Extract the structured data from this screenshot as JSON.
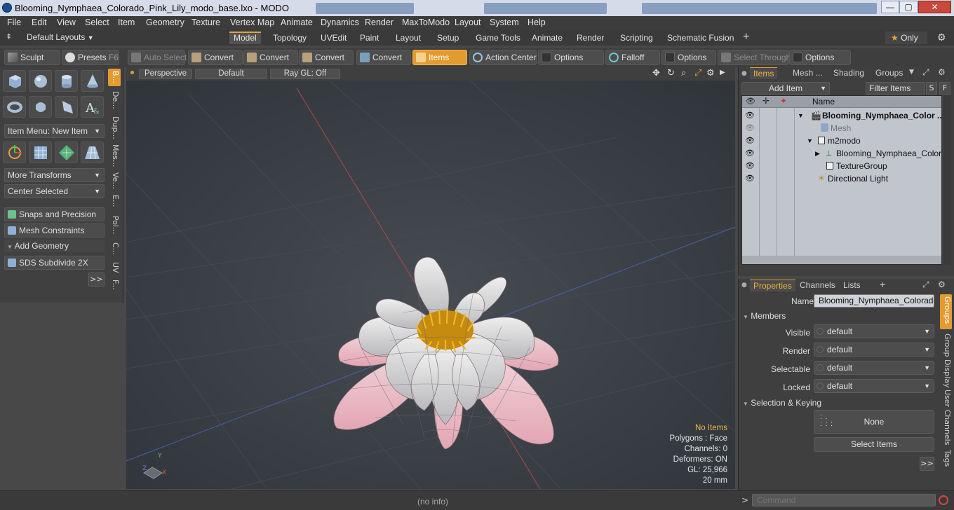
{
  "window": {
    "title": "Blooming_Nymphaea_Colorado_Pink_Lily_modo_base.lxo - MODO",
    "minimize": "—",
    "maximize": "▢",
    "close": "✕"
  },
  "menu": [
    "File",
    "Edit",
    "View",
    "Select",
    "Item",
    "Geometry",
    "Texture",
    "Vertex Map",
    "Animate",
    "Dynamics",
    "Render",
    "MaxToModo",
    "Layout",
    "System",
    "Help"
  ],
  "layout_bar": {
    "layouts_label": "Default Layouts",
    "tabs": [
      "Model",
      "Topology",
      "UVEdit",
      "Paint",
      "Layout",
      "Setup",
      "Game Tools",
      "Animate",
      "Render",
      "Scripting",
      "Schematic Fusion"
    ],
    "active_tab": "Model",
    "add": "+",
    "only_label": "Only"
  },
  "toolbar": {
    "sculpt": "Sculpt",
    "presets": "Presets",
    "presets_key": "F6",
    "auto_select": "Auto Select",
    "convert1": "Convert",
    "convert2": "Convert",
    "convert3": "Convert",
    "convert4": "Convert",
    "items": "Items",
    "action_center": "Action Center",
    "options1": "Options",
    "falloff": "Falloff",
    "options2": "Options",
    "select_through": "Select Through",
    "options3": "Options"
  },
  "left_panel": {
    "item_menu": "Item Menu: New Item",
    "more_transforms": "More Transforms",
    "center_selected": "Center Selected",
    "snaps": "Snaps and Precision",
    "mesh_constraints": "Mesh Constraints",
    "add_geometry": "Add Geometry",
    "sds": "SDS Subdivide 2X",
    "more": ">>",
    "vertical_tabs": [
      "B...",
      "De...",
      "Dup...",
      "Mes...",
      "Ve...",
      "E...",
      "Pol...",
      "C...",
      "UV",
      "F..."
    ]
  },
  "viewport": {
    "view": "Perspective",
    "shading": "Default",
    "raygl": "Ray GL: Off",
    "stats": {
      "no_items": "No Items",
      "polygons": "Polygons : Face",
      "channels": "Channels: 0",
      "deformers": "Deformers: ON",
      "gl": "GL: 25,966",
      "scale": "20 mm"
    }
  },
  "items_panel": {
    "tabs": [
      "Items",
      "Mesh ...",
      "Shading",
      "Groups"
    ],
    "active_tab": "Items",
    "add_item": "Add Item",
    "filter_items": "Filter Items",
    "s_btn": "S",
    "f_btn": "F",
    "col_name": "Name",
    "rows": [
      {
        "label": "Blooming_Nymphaea_Color ...",
        "bold": true
      },
      {
        "label": "Mesh",
        "dim": true
      },
      {
        "label": "m2modo"
      },
      {
        "label": "Blooming_Nymphaea_Color ..."
      },
      {
        "label": "TextureGroup"
      },
      {
        "label": "Directional Light"
      }
    ]
  },
  "properties_panel": {
    "tabs": [
      "Properties",
      "Channels",
      "Lists"
    ],
    "active_tab": "Properties",
    "add": "+",
    "name_label": "Name",
    "name_value": "Blooming_Nymphaea_Colorado_P",
    "members": "Members",
    "fields": [
      {
        "label": "Visible",
        "value": "default"
      },
      {
        "label": "Render",
        "value": "default"
      },
      {
        "label": "Selectable",
        "value": "default"
      },
      {
        "label": "Locked",
        "value": "default"
      }
    ],
    "selection_keying": "Selection & Keying",
    "none_btn": "None",
    "select_items": "Select Items",
    "more": ">>",
    "side_tabs": [
      "Groups",
      "Group Display",
      "User Channels",
      "Tags"
    ]
  },
  "status": {
    "info": "(no info)",
    "command_placeholder": "Command",
    "prompt": ">"
  }
}
